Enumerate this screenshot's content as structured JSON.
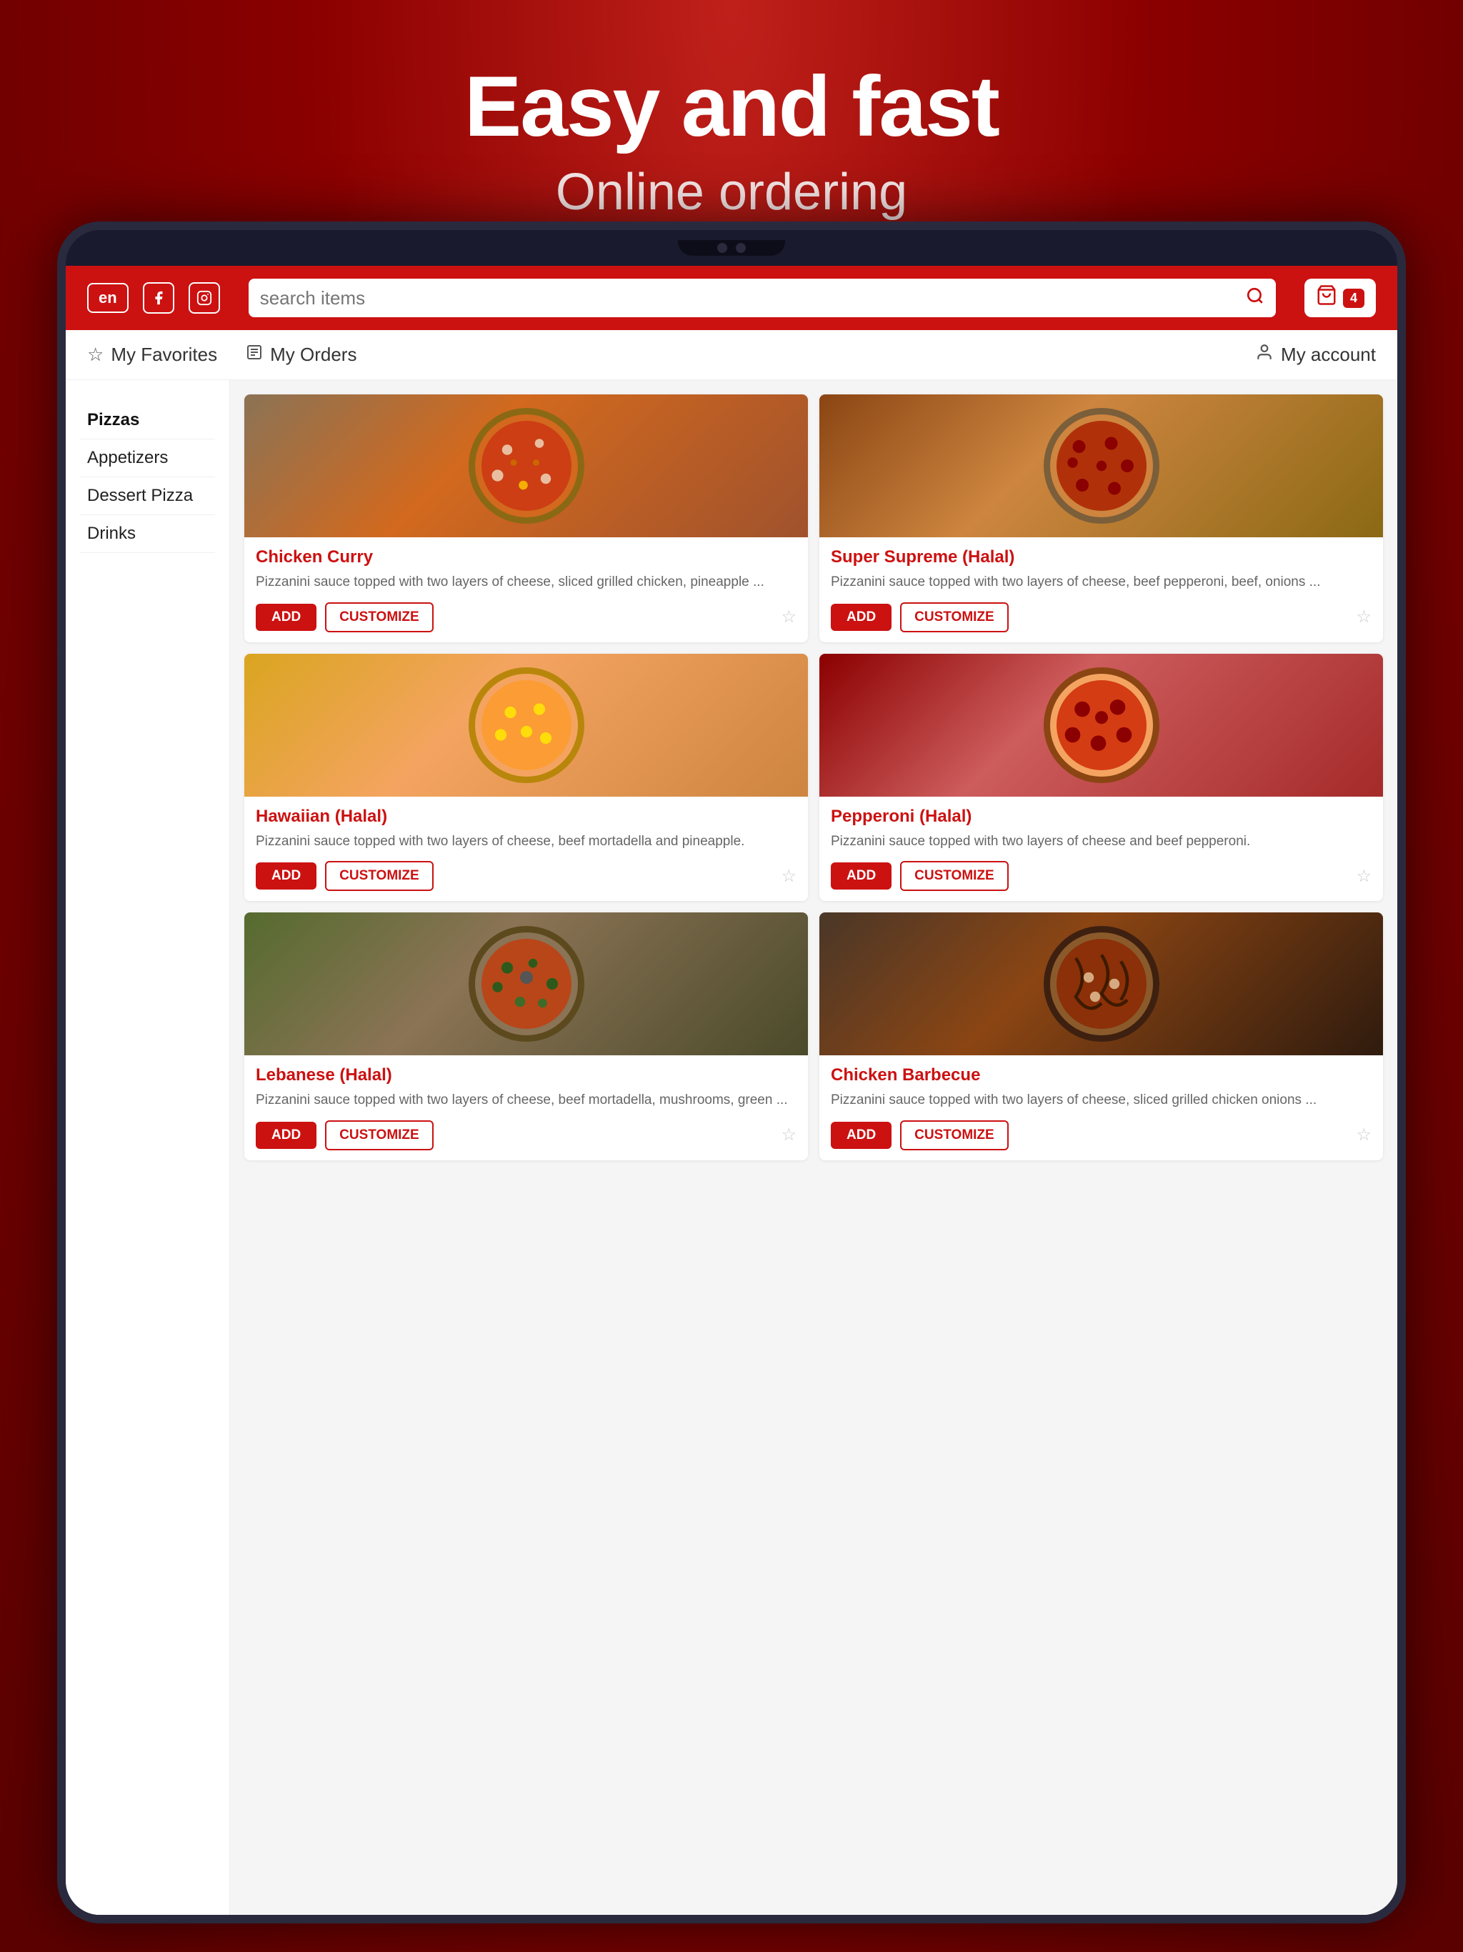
{
  "hero": {
    "title": "Easy and fast",
    "subtitle": "Online ordering"
  },
  "header": {
    "lang_label": "en",
    "search_placeholder": "search items",
    "cart_count": "4"
  },
  "nav": {
    "favorites_label": "My Favorites",
    "orders_label": "My Orders",
    "account_label": "My account"
  },
  "sidebar": {
    "items": [
      {
        "label": "Pizzas"
      },
      {
        "label": "Appetizers"
      },
      {
        "label": "Dessert Pizza"
      },
      {
        "label": "Drinks"
      }
    ]
  },
  "products": [
    {
      "id": "chicken-curry",
      "name": "Chicken Curry",
      "description": "Pizzanini sauce topped with two layers of cheese, sliced grilled chicken, pineapple ...",
      "add_label": "ADD",
      "customize_label": "CUSTOMIZE",
      "img_class": "img-chicken-curry"
    },
    {
      "id": "super-supreme",
      "name": "Super Supreme (Halal)",
      "description": "Pizzanini sauce topped with two layers of cheese, beef pepperoni, beef, onions ...",
      "add_label": "ADD",
      "customize_label": "CUSTOMIZE",
      "img_class": "img-super-supreme"
    },
    {
      "id": "hawaiian",
      "name": "Hawaiian (Halal)",
      "description": "Pizzanini sauce topped with two layers of cheese, beef mortadella and pineapple.",
      "add_label": "ADD",
      "customize_label": "CUSTOMIZE",
      "img_class": "img-hawaiian"
    },
    {
      "id": "pepperoni",
      "name": "Pepperoni (Halal)",
      "description": "Pizzanini sauce topped with two layers of cheese and beef pepperoni.",
      "add_label": "ADD",
      "customize_label": "CUSTOMIZE",
      "img_class": "img-pepperoni"
    },
    {
      "id": "lebanese",
      "name": "Lebanese (Halal)",
      "description": "Pizzanini sauce topped with two layers of cheese, beef mortadella, mushrooms, green ...",
      "add_label": "ADD",
      "customize_label": "CUSTOMIZE",
      "img_class": "img-lebanese"
    },
    {
      "id": "chicken-bbq",
      "name": "Chicken Barbecue",
      "description": "Pizzanini sauce topped with two layers of cheese, sliced grilled chicken onions ...",
      "add_label": "ADD",
      "customize_label": "CUSTOMIZE",
      "img_class": "img-chicken-bbq"
    }
  ]
}
